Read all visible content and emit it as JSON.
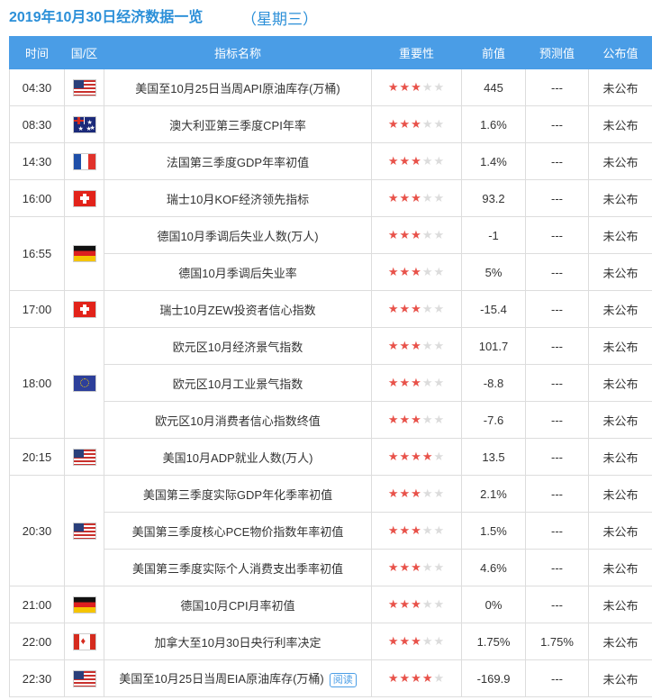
{
  "header": {
    "title": "2019年10月30日经济数据一览",
    "weekday": "（星期三）"
  },
  "columns": [
    "时间",
    "国/区",
    "指标名称",
    "重要性",
    "前值",
    "预测值",
    "公布值"
  ],
  "icons": {
    "flag_us": "us-flag-icon",
    "flag_au": "au-flag-icon",
    "flag_fr": "fr-flag-icon",
    "flag_ch": "ch-flag-icon",
    "flag_de": "de-flag-icon",
    "flag_eu": "eu-flag-icon",
    "flag_ca": "ca-flag-icon"
  },
  "colors": {
    "header_bg": "#4a9de6",
    "title": "#2b8fd8",
    "accent_red": "#e0483f",
    "star_on": "#e8524a",
    "star_off": "#dcdcdc"
  },
  "groups": [
    {
      "time": "04:30",
      "country": "us",
      "items": [
        {
          "name": "美国至10月25日当周API原油库存(万桶)",
          "stars": 3,
          "prev": "445",
          "forecast": "---",
          "actual": "未公布"
        }
      ]
    },
    {
      "time": "08:30",
      "country": "au",
      "items": [
        {
          "name": "澳大利亚第三季度CPI年率",
          "stars": 3,
          "prev": "1.6%",
          "forecast": "---",
          "actual": "未公布"
        }
      ]
    },
    {
      "time": "14:30",
      "country": "fr",
      "items": [
        {
          "name": "法国第三季度GDP年率初值",
          "stars": 3,
          "prev": "1.4%",
          "forecast": "---",
          "actual": "未公布"
        }
      ]
    },
    {
      "time": "16:00",
      "country": "ch",
      "items": [
        {
          "name": "瑞士10月KOF经济领先指标",
          "stars": 3,
          "prev": "93.2",
          "forecast": "---",
          "actual": "未公布"
        }
      ]
    },
    {
      "time": "16:55",
      "country": "de",
      "items": [
        {
          "name": "德国10月季调后失业人数(万人)",
          "stars": 3,
          "prev": "-1",
          "forecast": "---",
          "actual": "未公布"
        },
        {
          "name": "德国10月季调后失业率",
          "stars": 3,
          "prev": "5%",
          "forecast": "---",
          "actual": "未公布"
        }
      ]
    },
    {
      "time": "17:00",
      "country": "ch",
      "items": [
        {
          "name": "瑞士10月ZEW投资者信心指数",
          "stars": 3,
          "prev": "-15.4",
          "forecast": "---",
          "actual": "未公布"
        }
      ]
    },
    {
      "time": "18:00",
      "country": "eu",
      "items": [
        {
          "name": "欧元区10月经济景气指数",
          "stars": 3,
          "prev": "101.7",
          "forecast": "---",
          "actual": "未公布"
        },
        {
          "name": "欧元区10月工业景气指数",
          "stars": 3,
          "prev": "-8.8",
          "forecast": "---",
          "actual": "未公布"
        },
        {
          "name": "欧元区10月消费者信心指数终值",
          "stars": 3,
          "prev": "-7.6",
          "forecast": "---",
          "actual": "未公布"
        }
      ]
    },
    {
      "time": "20:15",
      "country": "us",
      "items": [
        {
          "name": "美国10月ADP就业人数(万人)",
          "stars": 4,
          "prev": "13.5",
          "forecast": "---",
          "actual": "未公布"
        }
      ]
    },
    {
      "time": "20:30",
      "country": "us",
      "items": [
        {
          "name": "美国第三季度实际GDP年化季率初值",
          "stars": 3,
          "prev": "2.1%",
          "forecast": "---",
          "actual": "未公布"
        },
        {
          "name": "美国第三季度核心PCE物价指数年率初值",
          "stars": 3,
          "prev": "1.5%",
          "forecast": "---",
          "actual": "未公布"
        },
        {
          "name": "美国第三季度实际个人消费支出季率初值",
          "stars": 3,
          "prev": "4.6%",
          "forecast": "---",
          "actual": "未公布"
        }
      ]
    },
    {
      "time": "21:00",
      "country": "de",
      "items": [
        {
          "name": "德国10月CPI月率初值",
          "stars": 3,
          "prev": "0%",
          "forecast": "---",
          "actual": "未公布"
        }
      ]
    },
    {
      "time": "22:00",
      "country": "ca",
      "items": [
        {
          "name": "加拿大至10月30日央行利率决定",
          "stars": 3,
          "prev": "1.75%",
          "forecast": "1.75%",
          "actual": "未公布"
        }
      ]
    },
    {
      "time": "22:30",
      "country": "us",
      "items": [
        {
          "name": "美国至10月25日当周EIA原油库存(万桶)",
          "stars": 4,
          "prev": "-169.9",
          "forecast": "---",
          "actual": "未公布",
          "tag": "阅读"
        }
      ]
    }
  ]
}
